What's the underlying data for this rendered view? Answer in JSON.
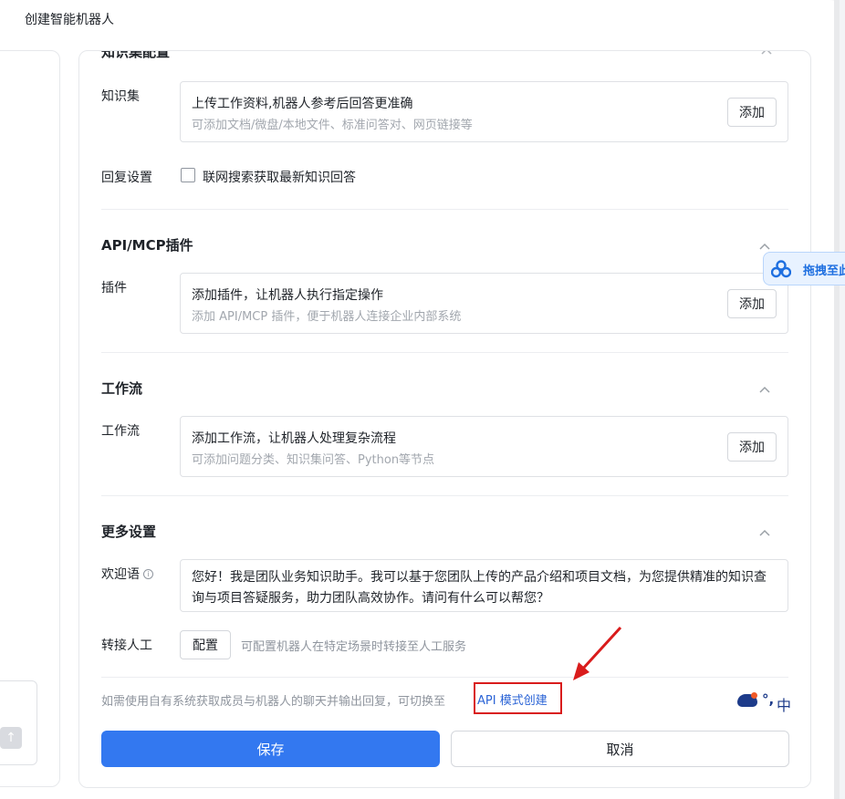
{
  "window": {
    "title": "创建智能机器人"
  },
  "knowledge": {
    "section_title_cut": "知识集配置",
    "label": "知识集",
    "title": "上传工作资料,机器人参考后回答更准确",
    "subtitle": "可添加文档/微盘/本地文件、标准问答对、网页链接等",
    "add_label": "添加"
  },
  "reply": {
    "label": "回复设置",
    "checkbox_label": "联网搜索获取最新知识回答",
    "checked": false
  },
  "plugins": {
    "section_title": "API/MCP插件",
    "label": "插件",
    "title": "添加插件，让机器人执行指定操作",
    "subtitle": "添加 API/MCP 插件，便于机器人连接企业内部系统",
    "add_label": "添加"
  },
  "workflow": {
    "section_title": "工作流",
    "label": "工作流",
    "title": "添加工作流，让机器人处理复杂流程",
    "subtitle": "可添加问题分类、知识集问答、Python等节点",
    "add_label": "添加"
  },
  "more": {
    "section_title": "更多设置",
    "welcome_label": "欢迎语",
    "info_icon": "i",
    "welcome_text": "您好！我是团队业务知识助手。我可以基于您团队上传的产品介绍和项目文档，为您提供精准的知识查询与项目答疑服务，助力团队高效协作。请问有什么可以帮您？",
    "transfer_label": "转接人工",
    "config_label": "配置",
    "config_desc": "可配置机器人在特定场景时转接至人工服务"
  },
  "footer": {
    "api_hint": "如需使用自有系统获取成员与机器人的聊天并输出回复，可切换至",
    "api_link": "API 模式创建",
    "save_label": "保存",
    "cancel_label": "取消"
  },
  "ime": {
    "punct": "°,",
    "lang": "中"
  },
  "drag_widget": {
    "label": "拖拽至此"
  },
  "scroll_top": {
    "glyph": "↑"
  },
  "colors": {
    "primary": "#3378f0",
    "link": "#2b64d6",
    "highlight": "#d91c1c"
  }
}
